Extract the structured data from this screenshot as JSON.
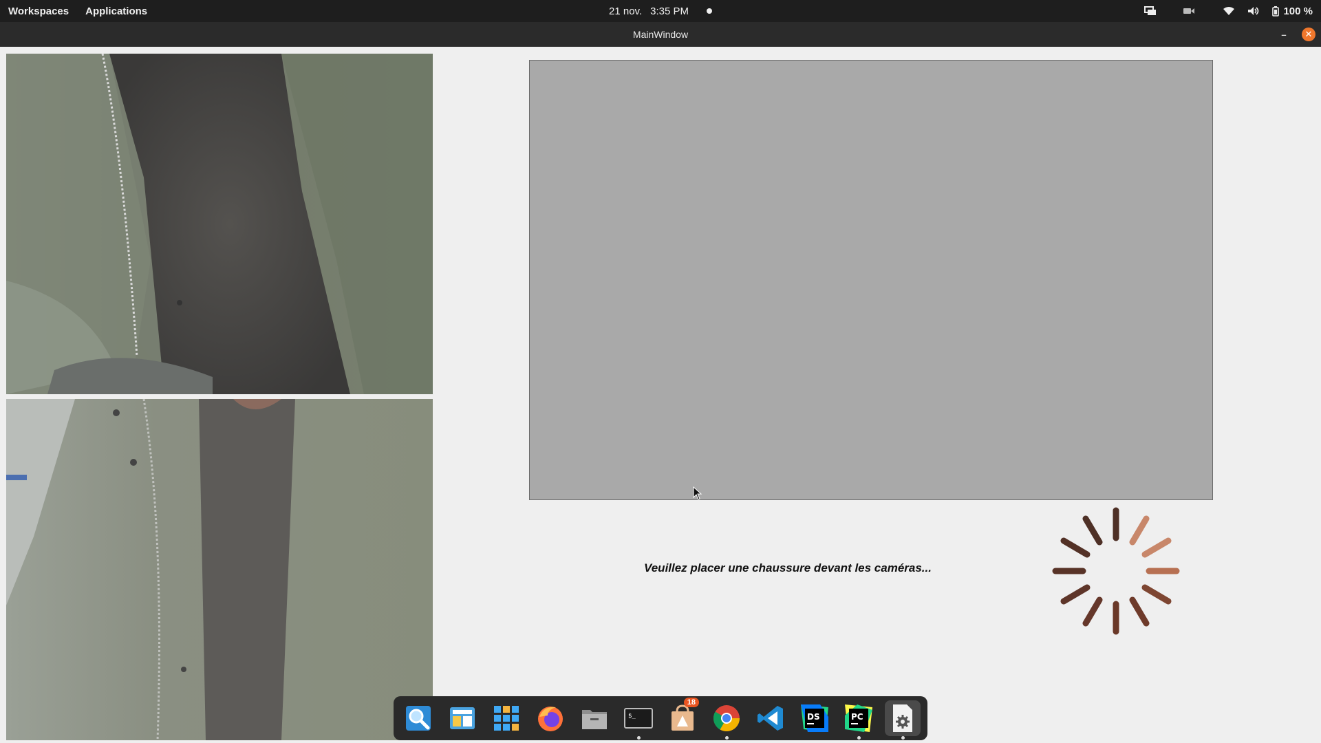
{
  "topbar": {
    "workspaces": "Workspaces",
    "applications": "Applications",
    "date": "21 nov.",
    "time": "3:35 PM",
    "battery": "100 %",
    "tray_icons": [
      "display-icon",
      "camera-icon",
      "wifi-icon",
      "volume-icon",
      "battery-icon"
    ]
  },
  "window": {
    "title": "MainWindow",
    "minimize_label": "–",
    "close_label": "✕"
  },
  "main": {
    "status_message": "Veuillez placer une chaussure devant les caméras...",
    "preview_color": "#a9a9a9"
  },
  "dock": {
    "items": [
      {
        "name": "search",
        "icon": "magnifier-icon"
      },
      {
        "name": "window-manager",
        "icon": "window-icon"
      },
      {
        "name": "app-grid",
        "icon": "grid-icon"
      },
      {
        "name": "firefox",
        "icon": "firefox-icon"
      },
      {
        "name": "files",
        "icon": "folder-icon"
      },
      {
        "name": "terminal",
        "icon": "terminal-icon"
      },
      {
        "name": "software-store",
        "icon": "store-icon",
        "badge": "18"
      },
      {
        "name": "chrome",
        "icon": "chrome-icon"
      },
      {
        "name": "vscode",
        "icon": "vscode-icon"
      },
      {
        "name": "dataspell",
        "icon": "ds-icon",
        "label": "DS"
      },
      {
        "name": "pycharm",
        "icon": "pc-icon",
        "label": "PC"
      },
      {
        "name": "settings-app",
        "icon": "gear-doc-icon"
      }
    ]
  },
  "colors": {
    "accent": "#f0772c",
    "topbar": "#1e1e1e",
    "spinner_dark": "#5b3326",
    "spinner_light": "#c8876a"
  }
}
